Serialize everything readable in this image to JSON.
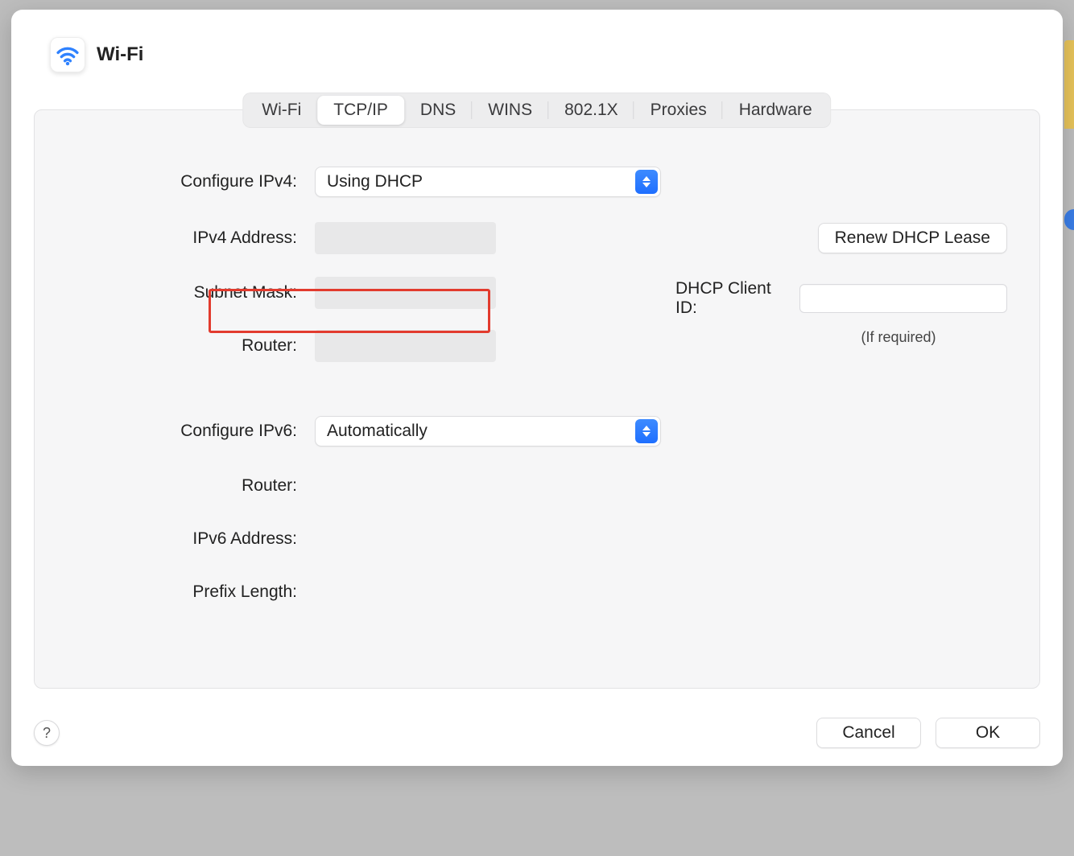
{
  "header": {
    "title": "Wi-Fi"
  },
  "tabs": [
    {
      "label": "Wi-Fi",
      "active": false
    },
    {
      "label": "TCP/IP",
      "active": true
    },
    {
      "label": "DNS",
      "active": false
    },
    {
      "label": "WINS",
      "active": false
    },
    {
      "label": "802.1X",
      "active": false
    },
    {
      "label": "Proxies",
      "active": false
    },
    {
      "label": "Hardware",
      "active": false
    }
  ],
  "ipv4": {
    "configure_label": "Configure IPv4:",
    "configure_value": "Using DHCP",
    "address_label": "IPv4 Address:",
    "subnet_label": "Subnet Mask:",
    "router_label": "Router:"
  },
  "dhcp": {
    "renew_label": "Renew DHCP Lease",
    "client_id_label": "DHCP Client ID:",
    "client_id_value": "",
    "hint": "(If required)"
  },
  "ipv6": {
    "configure_label": "Configure IPv6:",
    "configure_value": "Automatically",
    "router_label": "Router:",
    "address_label": "IPv6 Address:",
    "prefix_label": "Prefix Length:"
  },
  "footer": {
    "help": "?",
    "cancel": "Cancel",
    "ok": "OK"
  }
}
